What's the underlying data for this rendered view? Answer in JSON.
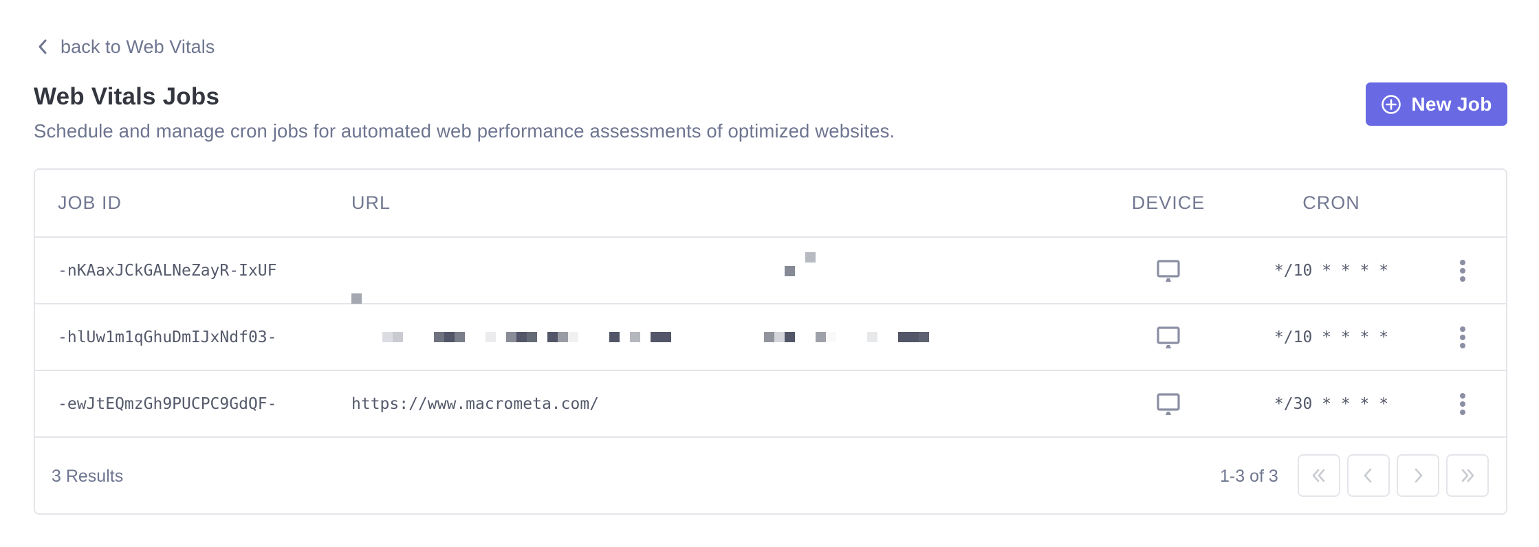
{
  "nav": {
    "back_label": "back to Web Vitals",
    "back_icon": "chevron-left-icon"
  },
  "header": {
    "title": "Web Vitals Jobs",
    "subtitle": "Schedule and manage cron jobs for automated web performance assessments of optimized websites.",
    "new_job_label": "New Job",
    "new_job_icon": "plus-circle-icon",
    "accent_color": "#6869e3"
  },
  "table": {
    "columns": [
      "JOB ID",
      "URL",
      "DEVICE",
      "CRON"
    ],
    "rows": [
      {
        "job_id": "-nKAaxJCkGALNeZayR-IxUF",
        "url": "",
        "url_obscured": true,
        "device": "desktop",
        "device_icon": "monitor-icon",
        "cron": "*/10 * * * *"
      },
      {
        "job_id": "-hlUw1m1qGhuDmIJxNdf03-",
        "url": "",
        "url_obscured": true,
        "device": "desktop",
        "device_icon": "monitor-icon",
        "cron": "*/10 * * * *"
      },
      {
        "job_id": "-ewJtEQmzGh9PUCPC9GdQF-",
        "url": "https://www.macrometa.com/",
        "url_obscured": false,
        "device": "desktop",
        "device_icon": "monitor-icon",
        "cron": "*/30 * * * *"
      }
    ],
    "row_menu_icon": "kebab-menu-icon"
  },
  "footer": {
    "results_label": "3 Results",
    "range_label": "1-3 of 3",
    "pager": [
      "first-page",
      "previous-page",
      "next-page",
      "last-page"
    ]
  }
}
